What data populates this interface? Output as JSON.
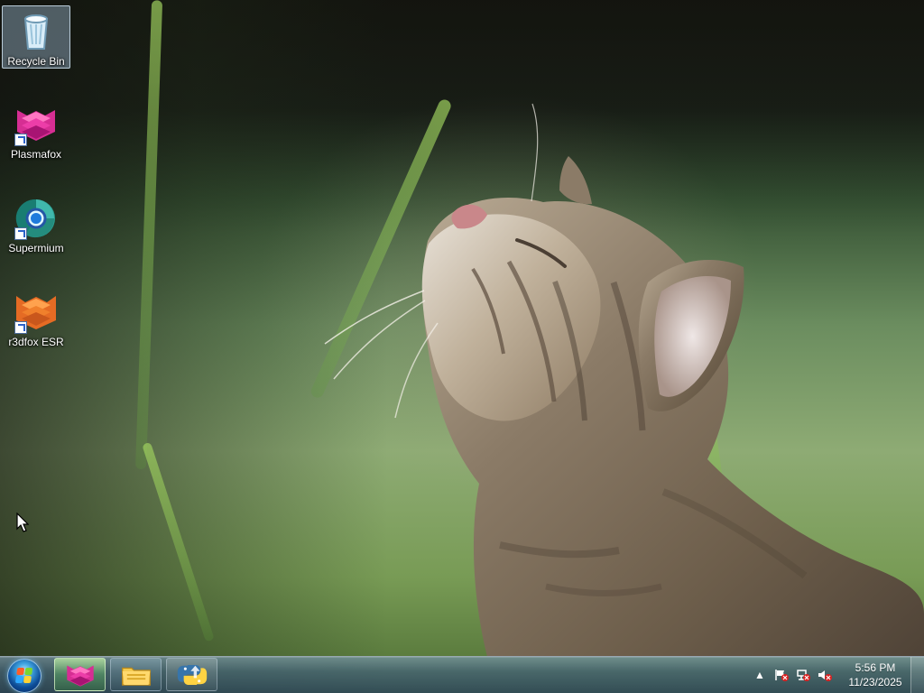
{
  "desktop": {
    "icons": [
      {
        "name": "recycle-bin",
        "label": "Recycle Bin",
        "icon": "recycle-bin-icon"
      },
      {
        "name": "plasmafox",
        "label": "Plasmafox",
        "icon": "plasmafox-icon"
      },
      {
        "name": "supermium",
        "label": "Supermium",
        "icon": "supermium-icon"
      },
      {
        "name": "r3dfox-esr",
        "label": "r3dfox ESR",
        "icon": "r3dfox-icon"
      }
    ]
  },
  "taskbar": {
    "buttons": [
      {
        "name": "plasmafox-taskbar-button",
        "icon": "plasmafox-icon"
      },
      {
        "name": "file-explorer-taskbar-button",
        "icon": "folder-icon"
      },
      {
        "name": "python-taskbar-button",
        "icon": "python-icon"
      }
    ],
    "tray": {
      "show_hidden_icon": "up-arrow-icon",
      "action_center_icon": "flag-warning-icon",
      "network_icon": "network-error-icon",
      "volume_icon": "volume-muted-icon"
    },
    "clock": {
      "time": "5:56 PM",
      "date": "11/23/2025"
    }
  },
  "colors": {
    "taskbar_bg": "#4f6f82",
    "active_button": "#76c779",
    "start_orb": "#2f8bd5",
    "plasmafox_pink": "#e63fa1",
    "r3dfox_orange": "#ef7b2d",
    "supermium_teal": "#2fa597"
  }
}
